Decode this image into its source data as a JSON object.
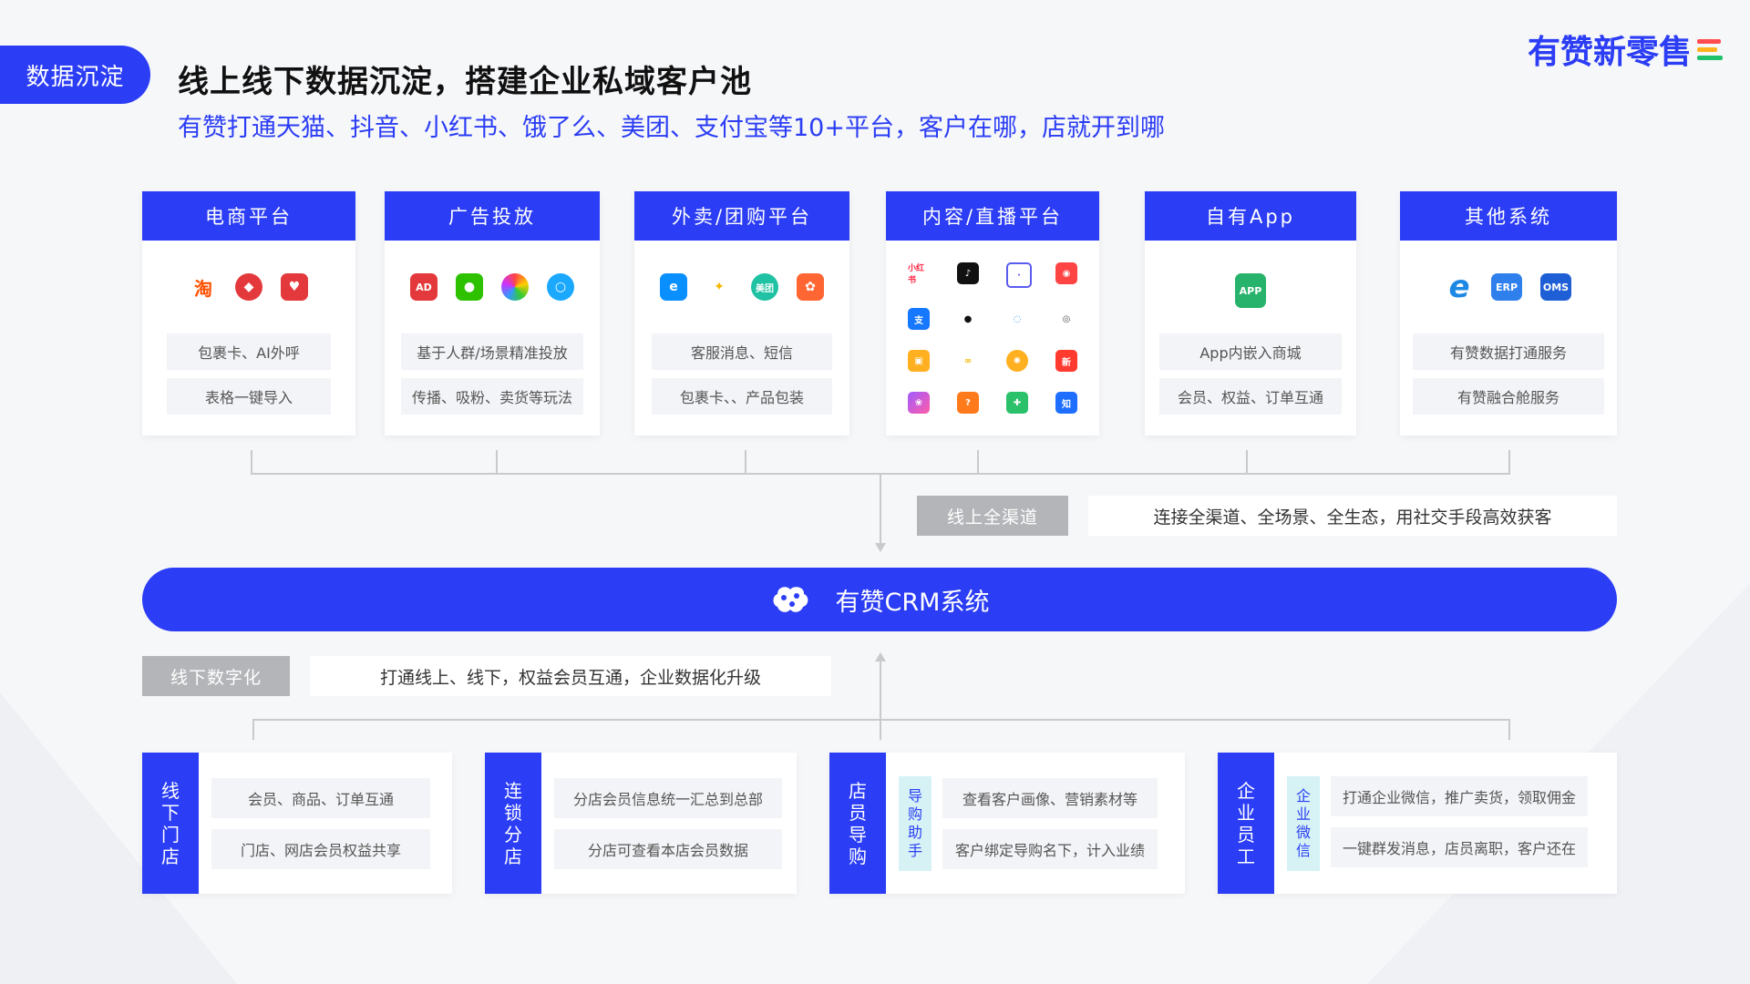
{
  "tag": "数据沉淀",
  "title": "线上线下数据沉淀，搭建企业私域客户池",
  "subtitle": "有赞打通天猫、抖音、小红书、饿了么、美团、支付宝等10+平台，客户在哪，店就开到哪",
  "brand": "有赞新零售",
  "colors": {
    "accent": "#2b3df5",
    "grey_box": "#b3b5b8"
  },
  "platforms": [
    {
      "title": "电商平台",
      "icons": [
        "taobao-icon",
        "tmall-icon",
        "gift-icon"
      ],
      "items": [
        "包裹卡、AI外呼",
        "表格一键导入"
      ]
    },
    {
      "title": "广告投放",
      "icons": [
        "ad-icon",
        "wechat-icon",
        "color-wheel-icon",
        "qq-bubble-icon"
      ],
      "items": [
        "基于人群/场景精准投放",
        "传播、吸粉、卖货等玩法"
      ]
    },
    {
      "title": "外卖/团购平台",
      "icons": [
        "eleme-icon",
        "meituan-waimai-icon",
        "meituan-icon",
        "dianping-icon"
      ],
      "items": [
        "客服消息、短信",
        "包裹卡、、产品包装"
      ]
    },
    {
      "title": "内容/直播平台",
      "icons": [
        "xiaohongshu-icon",
        "douyin-icon",
        "bilibili-icon",
        "toutiao-icon",
        "alipay-icon",
        "qq-icon",
        "weibo-chat-icon",
        "owl-icon",
        "live-icon",
        "butterfly-icon",
        "sunflower-icon",
        "news-icon",
        "flower-icon",
        "question-icon",
        "plus-icon",
        "zhihu-icon"
      ]
    },
    {
      "title": "自有App",
      "icons": [
        "app-icon"
      ],
      "items": [
        "App内嵌入商城",
        "会员、权益、订单互通"
      ]
    },
    {
      "title": "其他系统",
      "icons": [
        "ie-icon",
        "erp-icon",
        "oms-icon"
      ],
      "items": [
        "有赞数据打通服务",
        "有赞融合舱服务"
      ]
    }
  ],
  "online": {
    "label": "线上全渠道",
    "desc": "连接全渠道、全场景、全生态，用社交手段高效获客"
  },
  "crm": {
    "label": "有赞CRM系统"
  },
  "offline": {
    "label": "线下数字化",
    "desc": "打通线上、线下，权益会员互通，企业数据化升级"
  },
  "bottom": [
    {
      "side": "线下门店",
      "items": [
        "会员、商品、订单互通",
        "门店、网店会员权益共享"
      ]
    },
    {
      "side": "连锁分店",
      "items": [
        "分店会员信息统一汇总到总部",
        "分店可查看本店会员数据"
      ]
    },
    {
      "side": "店员导购",
      "sub": "导购助手",
      "items": [
        "查看客户画像、营销素材等",
        "客户绑定导购名下，计入业绩"
      ]
    },
    {
      "side": "企业员工",
      "sub": "企业微信",
      "items": [
        "打通企业微信，推广卖货，领取佣金",
        "一键群发消息，店员离职，客户还在"
      ]
    }
  ]
}
